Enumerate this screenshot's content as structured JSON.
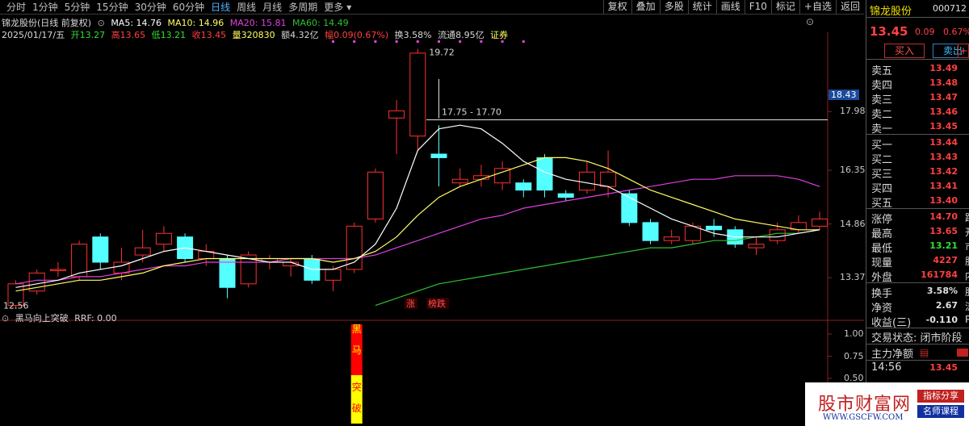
{
  "toolbar": {
    "periods": [
      "分时",
      "1分钟",
      "5分钟",
      "15分钟",
      "30分钟",
      "60分钟",
      "日线",
      "周线",
      "月线",
      "多周期",
      "更多"
    ],
    "active_period": 6,
    "more_caret": "▾",
    "buttons": [
      "复权",
      "叠加",
      "多股",
      "统计",
      "画线",
      "F10",
      "标记",
      "+自选",
      "返回"
    ]
  },
  "chart_header": {
    "stock": "锦龙股份(日线 前复权)",
    "ma5": "MA5: 14.76",
    "ma10": "MA10: 14.96",
    "ma20": "MA20: 15.81",
    "ma60": "MA60: 14.49"
  },
  "bar_info": {
    "date": "2025/01/17/五",
    "open": "开13.27",
    "high": "高13.65",
    "low": "低13.21",
    "close": "收13.45",
    "volume": "量320830",
    "amount": "额4.32亿",
    "change": "幅0.09(0.67%)",
    "turnover": "换3.58%",
    "float": "流通8.95亿",
    "tag": "证券"
  },
  "price_axis": [
    "18.43",
    "17.98",
    "16.35",
    "14.86",
    "13.37"
  ],
  "annotations": {
    "high_label": "19.72",
    "low_label": "12.56",
    "range_label": "17.75 - 17.70",
    "zt_tag": "涨",
    "rank_tag": "榜跌"
  },
  "indicator": {
    "title": "黑马向上突破",
    "rrf": "RRF: 0.00",
    "axis": [
      "1.00",
      "0.75",
      "0.50"
    ],
    "signal_chars": [
      "黑",
      "马",
      "突",
      "破"
    ]
  },
  "colors": {
    "up": "#ff3030",
    "down": "#54ffff",
    "ma5": "#ffffff",
    "ma10": "#ffff60",
    "ma20": "#e040e0",
    "ma60": "#30c030"
  },
  "chart_data": {
    "type": "candlestick",
    "ylim": [
      12.3,
      20.0
    ],
    "candles": [
      {
        "o": 12.6,
        "c": 13.2,
        "h": 13.3,
        "l": 12.5
      },
      {
        "o": 13.0,
        "c": 13.5,
        "h": 13.6,
        "l": 12.9
      },
      {
        "o": 13.6,
        "c": 13.6,
        "h": 13.8,
        "l": 13.4
      },
      {
        "o": 13.4,
        "c": 14.3,
        "h": 14.4,
        "l": 13.3
      },
      {
        "o": 14.5,
        "c": 13.8,
        "h": 14.6,
        "l": 13.6
      },
      {
        "o": 13.5,
        "c": 13.8,
        "h": 14.2,
        "l": 13.3
      },
      {
        "o": 14.0,
        "c": 14.2,
        "h": 14.7,
        "l": 13.8
      },
      {
        "o": 14.3,
        "c": 14.6,
        "h": 14.8,
        "l": 14.1
      },
      {
        "o": 14.5,
        "c": 13.9,
        "h": 14.6,
        "l": 13.8
      },
      {
        "o": 13.9,
        "c": 14.1,
        "h": 14.3,
        "l": 13.7
      },
      {
        "o": 13.9,
        "c": 13.1,
        "h": 14.0,
        "l": 12.8
      },
      {
        "o": 13.2,
        "c": 14.0,
        "h": 14.1,
        "l": 13.1
      },
      {
        "o": 13.8,
        "c": 13.9,
        "h": 14.0,
        "l": 13.6
      },
      {
        "o": 13.7,
        "c": 13.8,
        "h": 13.9,
        "l": 13.4
      },
      {
        "o": 13.9,
        "c": 13.3,
        "h": 14.0,
        "l": 13.2
      },
      {
        "o": 13.3,
        "c": 13.6,
        "h": 13.7,
        "l": 13.0
      },
      {
        "o": 13.6,
        "c": 14.8,
        "h": 14.9,
        "l": 13.5
      },
      {
        "o": 15.0,
        "c": 16.3,
        "h": 16.4,
        "l": 14.9
      },
      {
        "o": 17.8,
        "c": 18.0,
        "h": 18.3,
        "l": 16.8
      },
      {
        "o": 17.3,
        "c": 19.6,
        "h": 19.72,
        "l": 16.9
      },
      {
        "o": 16.8,
        "c": 16.7,
        "h": 17.6,
        "l": 15.9
      },
      {
        "o": 16.0,
        "c": 16.1,
        "h": 16.4,
        "l": 15.9
      },
      {
        "o": 16.1,
        "c": 16.2,
        "h": 16.5,
        "l": 15.9
      },
      {
        "o": 16.0,
        "c": 16.4,
        "h": 16.6,
        "l": 15.8
      },
      {
        "o": 16.0,
        "c": 15.8,
        "h": 16.1,
        "l": 15.6
      },
      {
        "o": 16.7,
        "c": 15.8,
        "h": 16.8,
        "l": 15.6
      },
      {
        "o": 15.7,
        "c": 15.6,
        "h": 15.8,
        "l": 15.5
      },
      {
        "o": 15.8,
        "c": 16.3,
        "h": 16.6,
        "l": 15.7
      },
      {
        "o": 15.9,
        "c": 16.3,
        "h": 16.9,
        "l": 15.6
      },
      {
        "o": 15.7,
        "c": 14.9,
        "h": 15.8,
        "l": 14.8
      },
      {
        "o": 14.9,
        "c": 14.4,
        "h": 15.0,
        "l": 14.3
      },
      {
        "o": 14.4,
        "c": 14.5,
        "h": 14.7,
        "l": 14.3
      },
      {
        "o": 14.4,
        "c": 14.8,
        "h": 14.9,
        "l": 14.3
      },
      {
        "o": 14.8,
        "c": 14.7,
        "h": 15.0,
        "l": 14.5
      },
      {
        "o": 14.7,
        "c": 14.3,
        "h": 14.8,
        "l": 14.2
      },
      {
        "o": 14.2,
        "c": 14.3,
        "h": 14.5,
        "l": 14.0
      },
      {
        "o": 14.4,
        "c": 14.7,
        "h": 14.9,
        "l": 14.3
      },
      {
        "o": 14.7,
        "c": 14.9,
        "h": 15.1,
        "l": 14.6
      },
      {
        "o": 14.8,
        "c": 15.0,
        "h": 15.2,
        "l": 14.7
      }
    ],
    "ma5": [
      13.1,
      13.2,
      13.3,
      13.5,
      13.6,
      13.7,
      13.9,
      14.1,
      14.2,
      14.1,
      14.0,
      13.9,
      13.8,
      13.8,
      13.6,
      13.6,
      13.8,
      14.3,
      15.3,
      16.9,
      17.5,
      17.6,
      17.5,
      17.1,
      16.6,
      16.3,
      16.1,
      16.0,
      15.9,
      15.6,
      15.3,
      15.0,
      14.8,
      14.6,
      14.5,
      14.5,
      14.5,
      14.6,
      14.7
    ],
    "ma10": [
      13.0,
      13.1,
      13.2,
      13.3,
      13.3,
      13.4,
      13.5,
      13.7,
      13.8,
      13.9,
      13.9,
      13.9,
      13.9,
      13.9,
      13.9,
      13.8,
      13.9,
      14.1,
      14.5,
      15.1,
      15.6,
      15.9,
      16.1,
      16.3,
      16.5,
      16.7,
      16.7,
      16.6,
      16.4,
      16.1,
      15.8,
      15.6,
      15.4,
      15.2,
      15.0,
      14.9,
      14.8,
      14.7,
      14.7
    ],
    "ma20": [
      13.2,
      13.3,
      13.3,
      13.4,
      13.4,
      13.5,
      13.6,
      13.7,
      13.7,
      13.8,
      13.8,
      13.8,
      13.8,
      13.9,
      13.9,
      13.9,
      13.9,
      14.0,
      14.2,
      14.4,
      14.6,
      14.8,
      15.0,
      15.1,
      15.3,
      15.4,
      15.5,
      15.6,
      15.7,
      15.8,
      15.9,
      16.0,
      16.1,
      16.1,
      16.2,
      16.2,
      16.2,
      16.1,
      15.9
    ],
    "ma60": [
      null,
      null,
      null,
      null,
      null,
      null,
      null,
      null,
      null,
      null,
      null,
      null,
      null,
      null,
      null,
      null,
      null,
      12.6,
      12.8,
      13.0,
      13.2,
      13.3,
      13.4,
      13.5,
      13.6,
      13.7,
      13.8,
      13.9,
      14.0,
      14.1,
      14.2,
      14.2,
      14.3,
      14.4,
      14.4,
      14.5,
      14.6,
      14.6,
      14.7
    ]
  },
  "quote": {
    "name": "锦龙股份",
    "code": "000712",
    "price": "13.45",
    "change": "0.09",
    "pct": "0.67%",
    "buy_label": "买入",
    "sell_label": "卖出",
    "plus": "+",
    "sells": [
      {
        "label": "卖五",
        "price": "13.49"
      },
      {
        "label": "卖四",
        "price": "13.48"
      },
      {
        "label": "卖三",
        "price": "13.47"
      },
      {
        "label": "卖二",
        "price": "13.46"
      },
      {
        "label": "卖一",
        "price": "13.45"
      }
    ],
    "buys": [
      {
        "label": "买一",
        "price": "13.44"
      },
      {
        "label": "买二",
        "price": "13.43"
      },
      {
        "label": "买三",
        "price": "13.42"
      },
      {
        "label": "买四",
        "price": "13.41"
      },
      {
        "label": "买五",
        "price": "13.40"
      }
    ],
    "stats": [
      {
        "label": "涨停",
        "value": "14.70",
        "ext": "跌"
      },
      {
        "label": "最高",
        "value": "13.65",
        "ext": "开"
      },
      {
        "label": "最低",
        "value": "13.21",
        "ext": "市"
      },
      {
        "label": "现量",
        "value": "4227",
        "ext": "股"
      },
      {
        "label": "外盘",
        "value": "161784",
        "ext": "内"
      }
    ],
    "extra": [
      {
        "label": "换手",
        "value": "3.58%",
        "ext": "股"
      },
      {
        "label": "净资",
        "value": "2.67",
        "ext": "流"
      },
      {
        "label": "收益(三)",
        "value": "-0.110",
        "ext": "P"
      }
    ],
    "trade_status": "交易状态: 闭市阶段",
    "main_flow": "主力净额",
    "time": "14:56",
    "time_price": "13.45"
  },
  "watermark": {
    "title": "股市财富网",
    "url": "WWW.GSCFW.COM",
    "tag1": "指标分享",
    "tag2": "名师课程"
  }
}
